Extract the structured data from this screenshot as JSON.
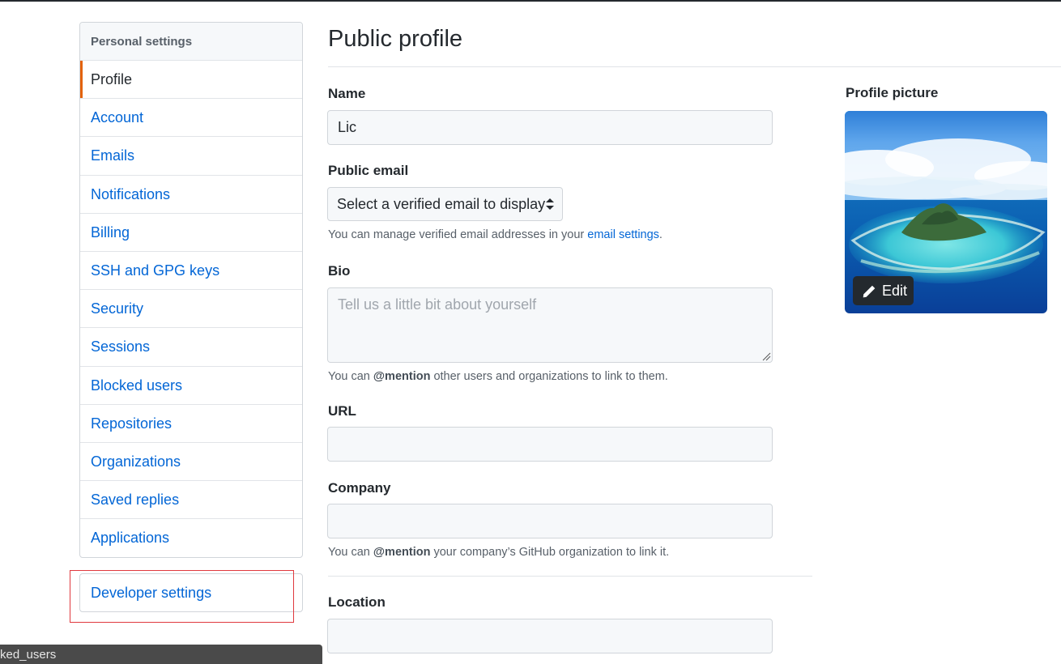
{
  "sidebar": {
    "heading": "Personal settings",
    "items": [
      {
        "label": "Profile",
        "selected": true
      },
      {
        "label": "Account"
      },
      {
        "label": "Emails"
      },
      {
        "label": "Notifications"
      },
      {
        "label": "Billing"
      },
      {
        "label": "SSH and GPG keys"
      },
      {
        "label": "Security"
      },
      {
        "label": "Sessions"
      },
      {
        "label": "Blocked users"
      },
      {
        "label": "Repositories"
      },
      {
        "label": "Organizations"
      },
      {
        "label": "Saved replies"
      },
      {
        "label": "Applications"
      }
    ],
    "developer_settings": "Developer settings"
  },
  "status_bar": {
    "text": "ked_users"
  },
  "main": {
    "title": "Public profile",
    "name": {
      "label": "Name",
      "value": "Lic"
    },
    "public_email": {
      "label": "Public email",
      "selected": "Select a verified email to display",
      "note_prefix": "You can manage verified email addresses in your ",
      "note_link": "email settings",
      "note_suffix": "."
    },
    "bio": {
      "label": "Bio",
      "placeholder": "Tell us a little bit about yourself",
      "note_prefix": "You can ",
      "note_mention": "@mention",
      "note_suffix": " other users and organizations to link to them."
    },
    "url": {
      "label": "URL",
      "value": ""
    },
    "company": {
      "label": "Company",
      "value": "",
      "note_prefix": "You can ",
      "note_mention": "@mention",
      "note_suffix": " your company’s GitHub organization to link it."
    },
    "location": {
      "label": "Location",
      "value": ""
    }
  },
  "profile_picture": {
    "label": "Profile picture",
    "edit_label": "Edit",
    "edit_icon": "pencil-icon"
  },
  "colors": {
    "link": "#0366d6",
    "selected_accent": "#e36209",
    "annotation_box": "#e0393e"
  }
}
